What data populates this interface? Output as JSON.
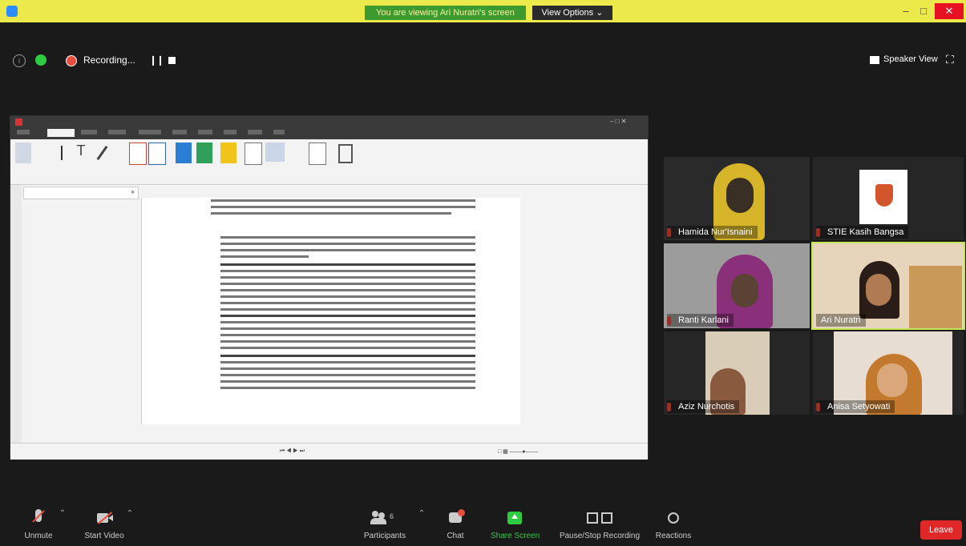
{
  "top_banner": {
    "viewing_text": "You are viewing Ari Nuratri's screen",
    "view_options_label": "View Options"
  },
  "meeting_toolbar": {
    "recording_label": "Recording...",
    "speaker_view_label": "Speaker View"
  },
  "participants": [
    {
      "name": "Hamida Nur'Isnaini"
    },
    {
      "name": "STIE Kasih Bangsa"
    },
    {
      "name": "Ranti Karlani"
    },
    {
      "name": "Ari Nuratri"
    },
    {
      "name": "Aziz Nurchotis"
    },
    {
      "name": "Anisa Setyowati"
    }
  ],
  "bottom_bar": {
    "unmute": "Unmute",
    "start_video": "Start Video",
    "participants": "Participants",
    "participants_count": "6",
    "chat": "Chat",
    "share_screen": "Share Screen",
    "pause_stop_recording": "Pause/Stop Recording",
    "reactions": "Reactions",
    "leave": "Leave"
  },
  "colors": {
    "banner_bg": "#ece94a",
    "viewing_bg": "#3c9a2e",
    "leave_bg": "#e02828",
    "active_speaker": "#c7e55a",
    "share_green": "#2ecc40"
  }
}
